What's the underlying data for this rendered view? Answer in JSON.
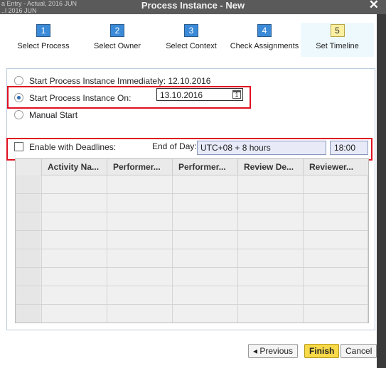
{
  "background_text": {
    "line1": "a Entry - Actual, 2016 JUN",
    "line2": "..l 2016 JUN"
  },
  "window": {
    "title": "Process Instance - New",
    "close_glyph": "✕"
  },
  "steps": [
    {
      "num": "1",
      "label": "Select Process"
    },
    {
      "num": "2",
      "label": "Select Owner"
    },
    {
      "num": "3",
      "label": "Select Context"
    },
    {
      "num": "4",
      "label": "Check Assignments"
    },
    {
      "num": "5",
      "label": "Set Timeline"
    }
  ],
  "active_step": "5",
  "options": {
    "immediate": "Start Process Instance Immediately: 12.10.2016",
    "start_on": "Start Process Instance On:",
    "start_on_date": "13.10.2016",
    "calendar_day": "1",
    "manual": "Manual Start",
    "deadlines": "Enable with Deadlines:",
    "selected": "start_on",
    "deadlines_checked": false
  },
  "end_of_day": {
    "label": "End of Day:",
    "timezone": "UTC+08 +  8 hours",
    "time": "18:00"
  },
  "table": {
    "columns": [
      "Activity Na...",
      "Performer...",
      "Performer...",
      "Review De...",
      "Reviewer..."
    ],
    "row_count": 8
  },
  "buttons": {
    "previous": "◂ Previous",
    "finish": "Finish",
    "cancel": "Cancel"
  },
  "colors": {
    "highlight_box": "#e01020",
    "finish_button": "#f7d94a",
    "step_number": "#3b8ad8",
    "active_step_number": "#fdf0a0"
  }
}
